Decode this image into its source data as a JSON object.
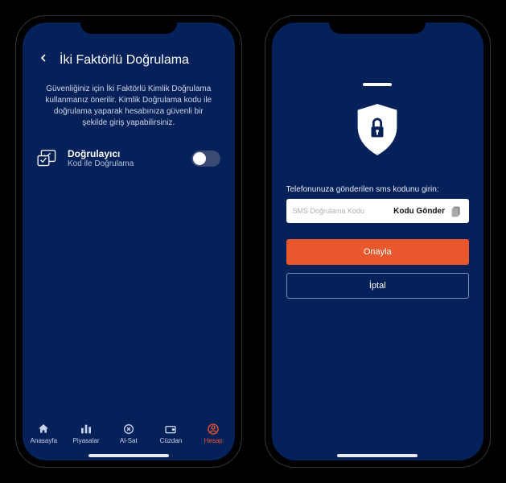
{
  "left": {
    "title": "İki Faktörlü Doğrulama",
    "description": "Güvenliğiniz için İki Faktörlü Kimlik Doğrulama kullanmanız önerilir. Kimlik Doğrulama kodu ile doğrulama yaparak hesabınıza güvenli bir şekilde giriş yapabilirsiniz.",
    "authenticator": {
      "title": "Doğrulayıcı",
      "subtitle": "Kod ile Doğrulama",
      "enabled": false
    },
    "tabs": [
      {
        "label": "Anasayfa"
      },
      {
        "label": "Piyasalar"
      },
      {
        "label": "Al-Sat"
      },
      {
        "label": "Cüzdan"
      },
      {
        "label": "Hesap"
      }
    ],
    "active_tab_index": 4
  },
  "right": {
    "prompt": "Telefonunuza gönderilen sms kodunu girin:",
    "input_placeholder": "SMS Doğrulama Kodu",
    "send_code_label": "Kodu Gönder",
    "confirm_label": "Onayla",
    "cancel_label": "İptal"
  },
  "colors": {
    "bg": "#05215a",
    "accent": "#e9572c"
  }
}
